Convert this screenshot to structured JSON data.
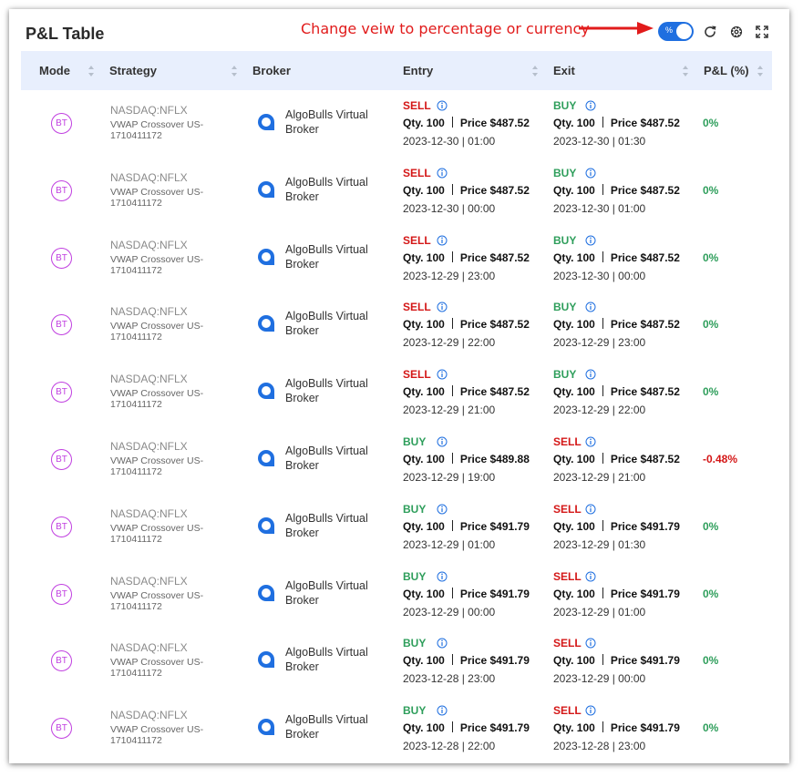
{
  "title": "P&L Table",
  "annotation": "Change veiw to percentage or currency",
  "toggle": {
    "label": "%",
    "state": "percentage"
  },
  "colors": {
    "accent": "#1f6fe0",
    "sell": "#d41717",
    "buy": "#2e9e5b",
    "badge": "#c03fe0",
    "header_bg": "#e8effd",
    "annotation": "#e11b1b"
  },
  "columns": [
    "Mode",
    "Strategy",
    "Broker",
    "Entry",
    "Exit",
    "P&L (%)"
  ],
  "rows": [
    {
      "mode": "BT",
      "symbol": "NASDAQ:NFLX",
      "strategy": "VWAP Crossover US-1710411172",
      "broker": "AlgoBulls Virtual Broker",
      "entry": {
        "side": "SELL",
        "qty": "Qty. 100",
        "price": "Price $487.52",
        "datetime": "2023-12-30 | 01:00"
      },
      "exit": {
        "side": "BUY",
        "qty": "Qty. 100",
        "price": "Price $487.52",
        "datetime": "2023-12-30 | 01:30"
      },
      "pl": "0%"
    },
    {
      "mode": "BT",
      "symbol": "NASDAQ:NFLX",
      "strategy": "VWAP Crossover US-1710411172",
      "broker": "AlgoBulls Virtual Broker",
      "entry": {
        "side": "SELL",
        "qty": "Qty. 100",
        "price": "Price $487.52",
        "datetime": "2023-12-30 | 00:00"
      },
      "exit": {
        "side": "BUY",
        "qty": "Qty. 100",
        "price": "Price $487.52",
        "datetime": "2023-12-30 | 01:00"
      },
      "pl": "0%"
    },
    {
      "mode": "BT",
      "symbol": "NASDAQ:NFLX",
      "strategy": "VWAP Crossover US-1710411172",
      "broker": "AlgoBulls Virtual Broker",
      "entry": {
        "side": "SELL",
        "qty": "Qty. 100",
        "price": "Price $487.52",
        "datetime": "2023-12-29 | 23:00"
      },
      "exit": {
        "side": "BUY",
        "qty": "Qty. 100",
        "price": "Price $487.52",
        "datetime": "2023-12-30 | 00:00"
      },
      "pl": "0%"
    },
    {
      "mode": "BT",
      "symbol": "NASDAQ:NFLX",
      "strategy": "VWAP Crossover US-1710411172",
      "broker": "AlgoBulls Virtual Broker",
      "entry": {
        "side": "SELL",
        "qty": "Qty. 100",
        "price": "Price $487.52",
        "datetime": "2023-12-29 | 22:00"
      },
      "exit": {
        "side": "BUY",
        "qty": "Qty. 100",
        "price": "Price $487.52",
        "datetime": "2023-12-29 | 23:00"
      },
      "pl": "0%"
    },
    {
      "mode": "BT",
      "symbol": "NASDAQ:NFLX",
      "strategy": "VWAP Crossover US-1710411172",
      "broker": "AlgoBulls Virtual Broker",
      "entry": {
        "side": "SELL",
        "qty": "Qty. 100",
        "price": "Price $487.52",
        "datetime": "2023-12-29 | 21:00"
      },
      "exit": {
        "side": "BUY",
        "qty": "Qty. 100",
        "price": "Price $487.52",
        "datetime": "2023-12-29 | 22:00"
      },
      "pl": "0%"
    },
    {
      "mode": "BT",
      "symbol": "NASDAQ:NFLX",
      "strategy": "VWAP Crossover US-1710411172",
      "broker": "AlgoBulls Virtual Broker",
      "entry": {
        "side": "BUY",
        "qty": "Qty. 100",
        "price": "Price $489.88",
        "datetime": "2023-12-29 | 19:00"
      },
      "exit": {
        "side": "SELL",
        "qty": "Qty. 100",
        "price": "Price $487.52",
        "datetime": "2023-12-29 | 21:00"
      },
      "pl": "-0.48%"
    },
    {
      "mode": "BT",
      "symbol": "NASDAQ:NFLX",
      "strategy": "VWAP Crossover US-1710411172",
      "broker": "AlgoBulls Virtual Broker",
      "entry": {
        "side": "BUY",
        "qty": "Qty. 100",
        "price": "Price $491.79",
        "datetime": "2023-12-29 | 01:00"
      },
      "exit": {
        "side": "SELL",
        "qty": "Qty. 100",
        "price": "Price $491.79",
        "datetime": "2023-12-29 | 01:30"
      },
      "pl": "0%"
    },
    {
      "mode": "BT",
      "symbol": "NASDAQ:NFLX",
      "strategy": "VWAP Crossover US-1710411172",
      "broker": "AlgoBulls Virtual Broker",
      "entry": {
        "side": "BUY",
        "qty": "Qty. 100",
        "price": "Price $491.79",
        "datetime": "2023-12-29 | 00:00"
      },
      "exit": {
        "side": "SELL",
        "qty": "Qty. 100",
        "price": "Price $491.79",
        "datetime": "2023-12-29 | 01:00"
      },
      "pl": "0%"
    },
    {
      "mode": "BT",
      "symbol": "NASDAQ:NFLX",
      "strategy": "VWAP Crossover US-1710411172",
      "broker": "AlgoBulls Virtual Broker",
      "entry": {
        "side": "BUY",
        "qty": "Qty. 100",
        "price": "Price $491.79",
        "datetime": "2023-12-28 | 23:00"
      },
      "exit": {
        "side": "SELL",
        "qty": "Qty. 100",
        "price": "Price $491.79",
        "datetime": "2023-12-29 | 00:00"
      },
      "pl": "0%"
    },
    {
      "mode": "BT",
      "symbol": "NASDAQ:NFLX",
      "strategy": "VWAP Crossover US-1710411172",
      "broker": "AlgoBulls Virtual Broker",
      "entry": {
        "side": "BUY",
        "qty": "Qty. 100",
        "price": "Price $491.79",
        "datetime": "2023-12-28 | 22:00"
      },
      "exit": {
        "side": "SELL",
        "qty": "Qty. 100",
        "price": "Price $491.79",
        "datetime": "2023-12-28 | 23:00"
      },
      "pl": "0%"
    }
  ]
}
